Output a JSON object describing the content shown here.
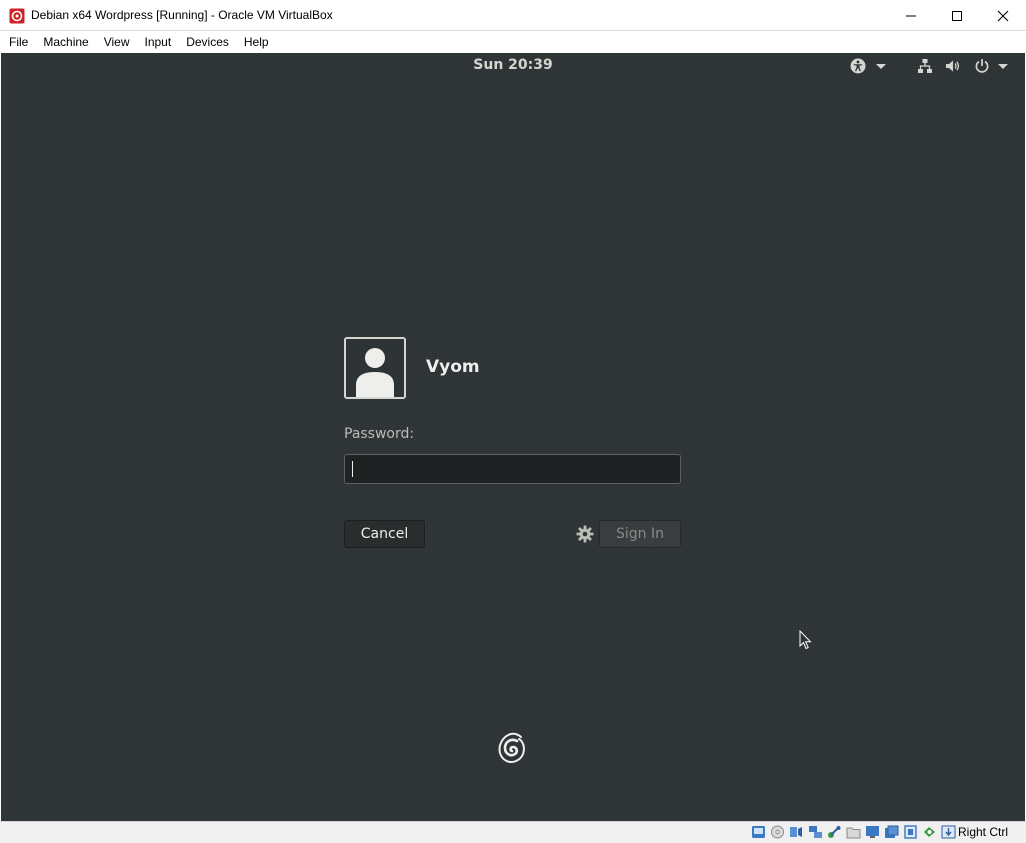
{
  "window": {
    "title": "Debian x64 Wordpress [Running] - Oracle VM VirtualBox",
    "app_icon": "virtualbox-icon",
    "controls": [
      "minimize-icon",
      "maximize-icon",
      "close-icon"
    ]
  },
  "menubar": {
    "items": [
      {
        "label": "File"
      },
      {
        "label": "Machine"
      },
      {
        "label": "View"
      },
      {
        "label": "Input"
      },
      {
        "label": "Devices"
      },
      {
        "label": "Help"
      }
    ]
  },
  "guest": {
    "topbar": {
      "clock": "Sun 20:39",
      "icons": [
        "accessibility-icon",
        "chevron-down-icon",
        "network-icon",
        "volume-icon",
        "power-icon",
        "chevron-down-icon"
      ]
    },
    "login": {
      "username": "Vyom",
      "password_label": "Password:",
      "password_value": "",
      "cancel_label": "Cancel",
      "signin_label": "Sign In",
      "session_icon": "gear-icon"
    },
    "logo": "debian-swirl-icon"
  },
  "statusbar": {
    "icons": [
      "hard-disk-icon",
      "optical-drive-icon",
      "audio-icon",
      "network-icon",
      "usb-icon",
      "shared-folders-icon",
      "display-icon",
      "video-capture-icon",
      "cpu-icon",
      "mouse-integration-icon",
      "keyboard-icon"
    ],
    "host_key": "Right Ctrl"
  },
  "colors": {
    "guest_background": "#2e3436",
    "text_light": "#eeeeec",
    "text_dim": "#babdb6",
    "vbox_red": "#d11f26"
  }
}
